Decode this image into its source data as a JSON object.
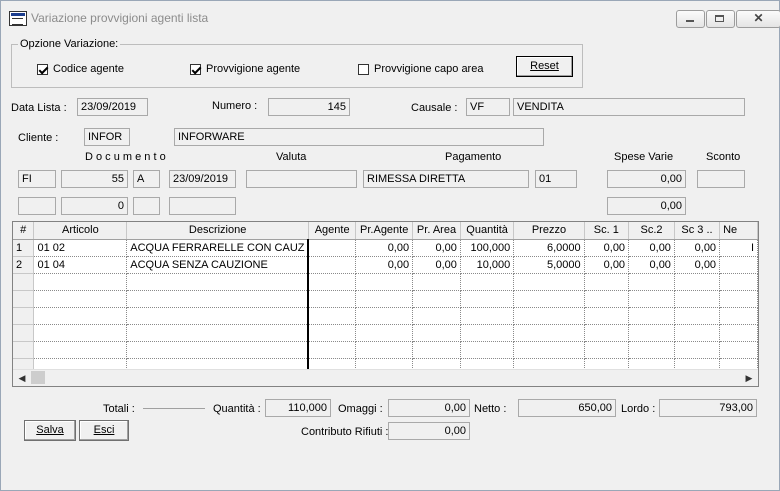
{
  "window": {
    "title": "Variazione provvigioni agenti lista",
    "controls": {
      "minimize": "minimize-icon",
      "maximize": "maximize-icon",
      "close": "close-icon"
    }
  },
  "options": {
    "group_label": "Opzione Variazione:",
    "codice_agente": {
      "label": "Codice agente",
      "checked": true
    },
    "provvigione_agente": {
      "label": "Provvigione agente",
      "checked": true
    },
    "provvigione_capo_area": {
      "label": "Provvigione capo area",
      "checked": false
    },
    "reset_label": "Reset"
  },
  "header": {
    "data_lista_label": "Data Lista :",
    "data_lista": "23/09/2019",
    "numero_label": "Numero :",
    "numero": "145",
    "causale_label": "Causale :",
    "causale_code": "VF",
    "causale_desc": "VENDITA",
    "cliente_label": "Cliente :",
    "cliente_code": "INFOR",
    "cliente_name": "INFORWARE"
  },
  "documento": {
    "section_label": "D o c u m e n t o",
    "valuta_label": "Valuta",
    "pagamento_label": "Pagamento",
    "spese_label": "Spese Varie",
    "sconto_label": "Sconto",
    "row1": {
      "tipo": "FI",
      "numero": "55",
      "serie": "A",
      "data": "23/09/2019",
      "valuta": "",
      "pagamento": "RIMESSA DIRETTA",
      "pag_code": "01",
      "spese": "0,00",
      "sconto": ""
    },
    "row2": {
      "tipo": "",
      "numero": "0",
      "serie": "",
      "data": "",
      "spese": "0,00"
    }
  },
  "grid": {
    "columns": [
      "#",
      "Articolo",
      "Descrizione",
      "Agente",
      "Pr.Agente",
      "Pr. Area",
      "Quantità",
      "Prezzo",
      "Sc. 1",
      "Sc.2",
      "Sc 3 ..",
      "Ne"
    ],
    "rows": [
      [
        "1",
        "01 02",
        "ACQUA FERRARELLE CON CAUZ",
        "",
        "0,00",
        "0,00",
        "100,000",
        "6,0000",
        "0,00",
        "0,00",
        "0,00",
        "I"
      ],
      [
        "2",
        "01 04",
        "ACQUA SENZA CAUZIONE",
        "",
        "0,00",
        "0,00",
        "10,000",
        "5,0000",
        "0,00",
        "0,00",
        "0,00",
        ""
      ]
    ],
    "scroll_left": "◀",
    "scroll_right": "▶"
  },
  "totals": {
    "totali_label": "Totali :",
    "quantita_label": "Quantità :",
    "quantita": "110,000",
    "omaggi_label": "Omaggi :",
    "omaggi": "0,00",
    "netto_label": "Netto :",
    "netto": "650,00",
    "lordo_label": "Lordo :",
    "lordo": "793,00",
    "contributo_label": "Contributo Rifiuti :",
    "contributo": "0,00"
  },
  "buttons": {
    "salva": "Salva",
    "esci": "Esci"
  }
}
